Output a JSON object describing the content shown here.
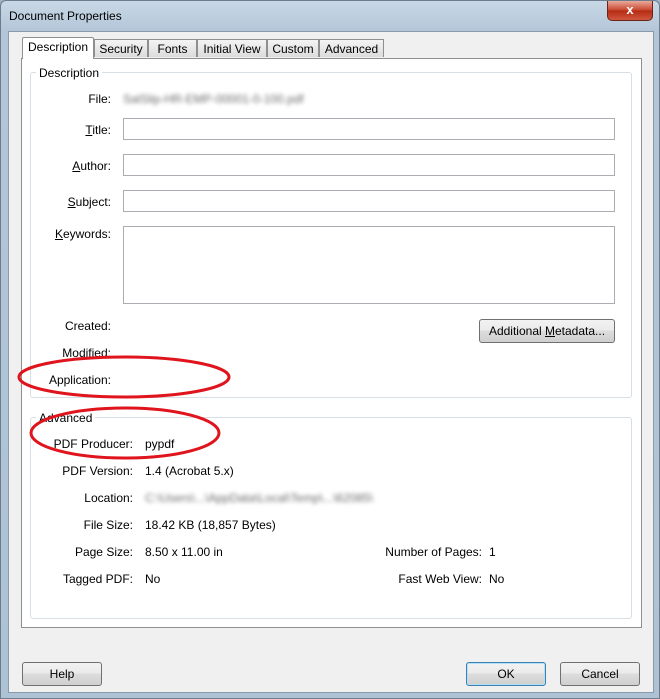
{
  "window": {
    "title": "Document Properties",
    "close_label": "x"
  },
  "tabs": [
    "Description",
    "Security",
    "Fonts",
    "Initial View",
    "Custom",
    "Advanced"
  ],
  "description": {
    "group_title": "Description",
    "file_label": "File:",
    "file_value": "SalSlip-HR-EMP-00001-0-100.pdf",
    "title_label_pre": "",
    "title_label_u": "T",
    "title_label_post": "itle:",
    "author_label_pre": "",
    "author_label_u": "A",
    "author_label_post": "uthor:",
    "subject_label_pre": "",
    "subject_label_u": "S",
    "subject_label_post": "ubject:",
    "keywords_label_pre": "",
    "keywords_label_u": "K",
    "keywords_label_post": "eywords:",
    "title_value": "",
    "author_value": "",
    "subject_value": "",
    "keywords_value": "",
    "created_label": "Created:",
    "modified_label": "Modified:",
    "application_label": "Application:",
    "metadata_button_pre": "Additional ",
    "metadata_button_u": "M",
    "metadata_button_post": "etadata..."
  },
  "advanced": {
    "group_title": "Advanced",
    "pdf_producer_label": "PDF Producer:",
    "pdf_producer_value": "pypdf",
    "pdf_version_label": "PDF Version:",
    "pdf_version_value": "1.4 (Acrobat 5.x)",
    "location_label": "Location:",
    "location_value": "C:\\Users\\...\\AppData\\Local\\Temp\\...\\62085\\",
    "file_size_label": "File Size:",
    "file_size_value": "18.42 KB (18,857 Bytes)",
    "page_size_label": "Page Size:",
    "page_size_value": "8.50 x 11.00 in",
    "num_pages_label": "Number of Pages:",
    "num_pages_value": "1",
    "tagged_pdf_label": "Tagged PDF:",
    "tagged_pdf_value": "No",
    "fast_web_view_label": "Fast Web View:",
    "fast_web_view_value": "No"
  },
  "buttons": {
    "help": "Help",
    "ok": "OK",
    "cancel": "Cancel"
  },
  "annotation_color": "#e0141c"
}
